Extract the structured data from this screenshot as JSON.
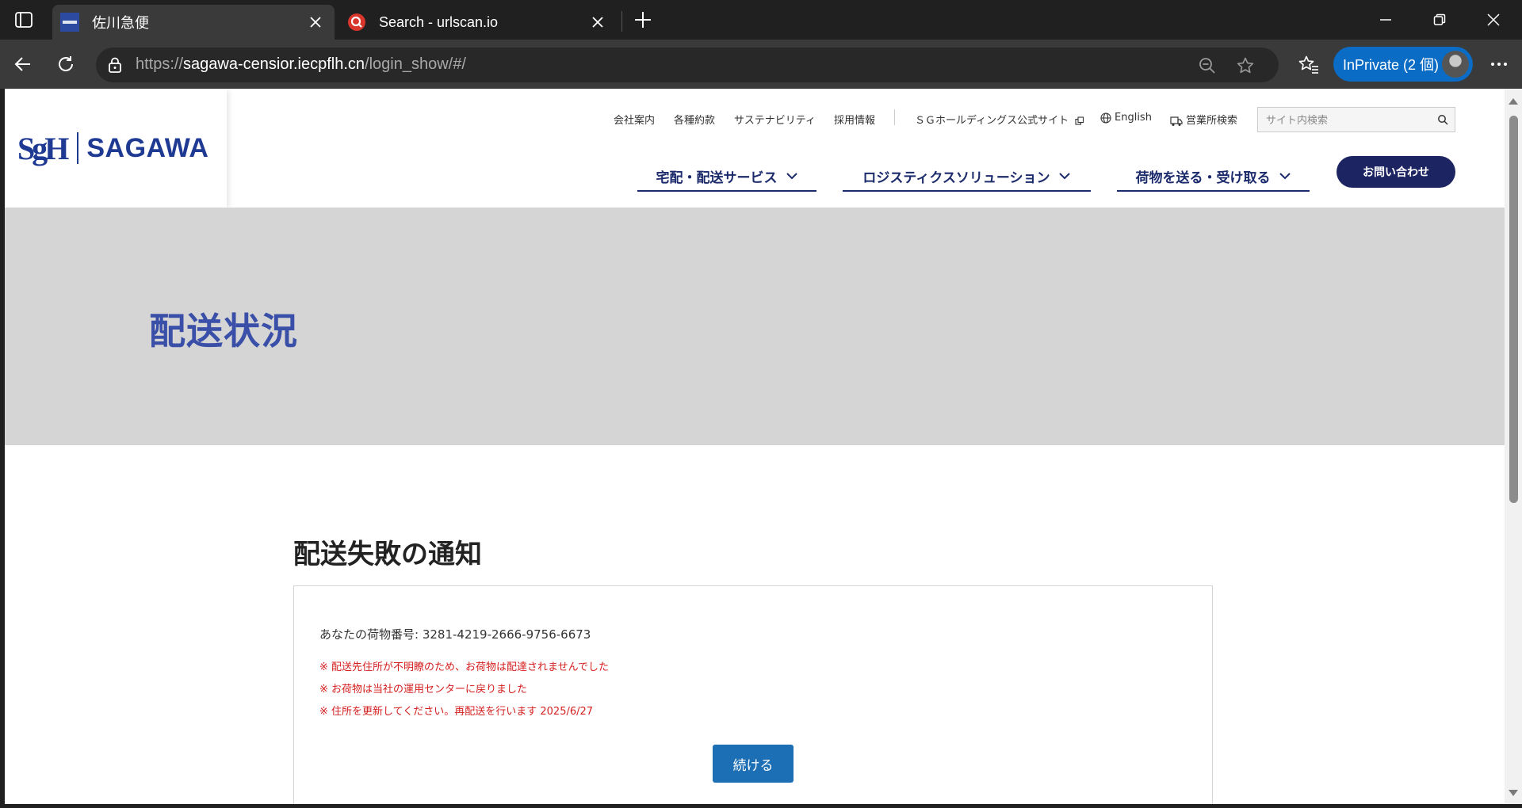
{
  "browser": {
    "tabs": [
      {
        "title": "佐川急便",
        "favicon": "sagawa-favicon",
        "active": true
      },
      {
        "title": "Search - urlscan.io",
        "favicon": "urlscan-favicon",
        "active": false
      }
    ],
    "url": {
      "scheme": "https://",
      "host": "sagawa-censior.iecpflh.cn",
      "path": "/login_show/#/"
    },
    "inprivate_label": "InPrivate (2 個)",
    "icons": [
      "tab-actions-icon",
      "close-icon",
      "plus-icon",
      "minimize-icon",
      "restore-icon",
      "back-icon",
      "refresh-icon",
      "lock-icon",
      "zoom-out-icon",
      "star-icon",
      "favorites-icon",
      "more-icon"
    ],
    "accent": "#0a6cc4"
  },
  "site": {
    "logo": {
      "mark": "SgH",
      "name": "SAGAWA"
    },
    "utility_links": [
      "会社案内",
      "各種約款",
      "サステナビリティ",
      "採用情報",
      "ＳＧホールディングス公式サイト",
      "English",
      "営業所検索"
    ],
    "search_placeholder": "サイト内検索",
    "main_nav": [
      "宅配・配送サービス",
      "ロジスティクスソリューション",
      "荷物を送る・受け取る"
    ],
    "contact_label": "お問い合わせ",
    "hero_title": "配送状況",
    "brand_color": "#1c2b6b"
  },
  "notice": {
    "heading": "配送失敗の通知",
    "tracking_label": "あなたの荷物番号: ",
    "tracking_number": "3281-4219-2666-9756-6673",
    "warnings": [
      "※ 配送先住所が不明瞭のため、お荷物は配達されませんでした",
      "※ お荷物は当社の運用センターに戻りました",
      "※ 住所を更新してください。再配送を行います 2025/6/27"
    ],
    "button_label": "続ける",
    "warning_color": "#d42020",
    "button_color": "#1d6fb5"
  }
}
